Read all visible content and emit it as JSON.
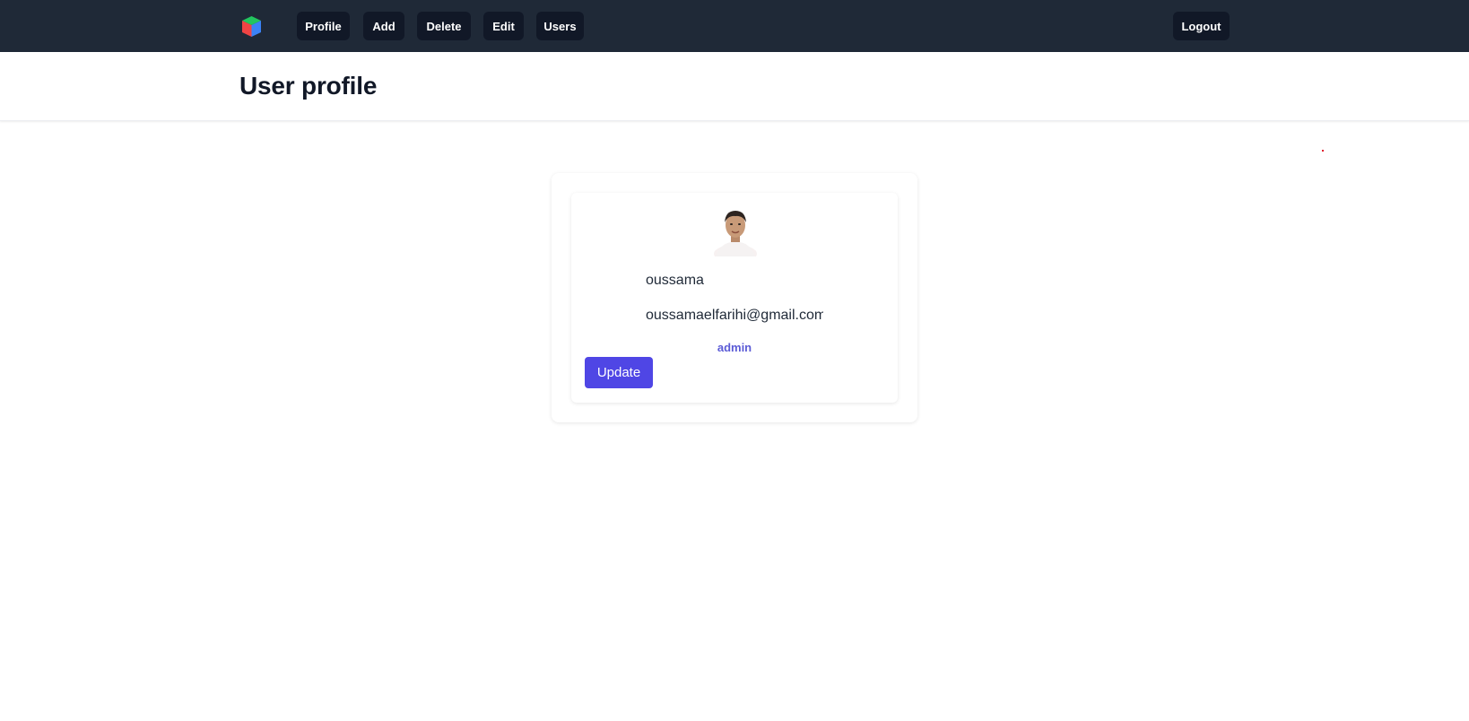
{
  "nav": {
    "items": [
      {
        "label": "Profile"
      },
      {
        "label": "Add"
      },
      {
        "label": "Delete"
      },
      {
        "label": "Edit"
      },
      {
        "label": "Users"
      }
    ],
    "logout_label": "Logout",
    "logo_icon": "cube-logo-icon"
  },
  "header": {
    "title": "User profile"
  },
  "profile": {
    "avatar_icon": "user-avatar",
    "name": "oussama",
    "email": "oussamaelfarihi@gmail.com",
    "role": "admin",
    "update_label": "Update"
  },
  "colors": {
    "nav_bg": "#1f2937",
    "nav_button_bg": "#111827",
    "accent": "#4f46e5",
    "role_text": "#5b5bd6"
  }
}
